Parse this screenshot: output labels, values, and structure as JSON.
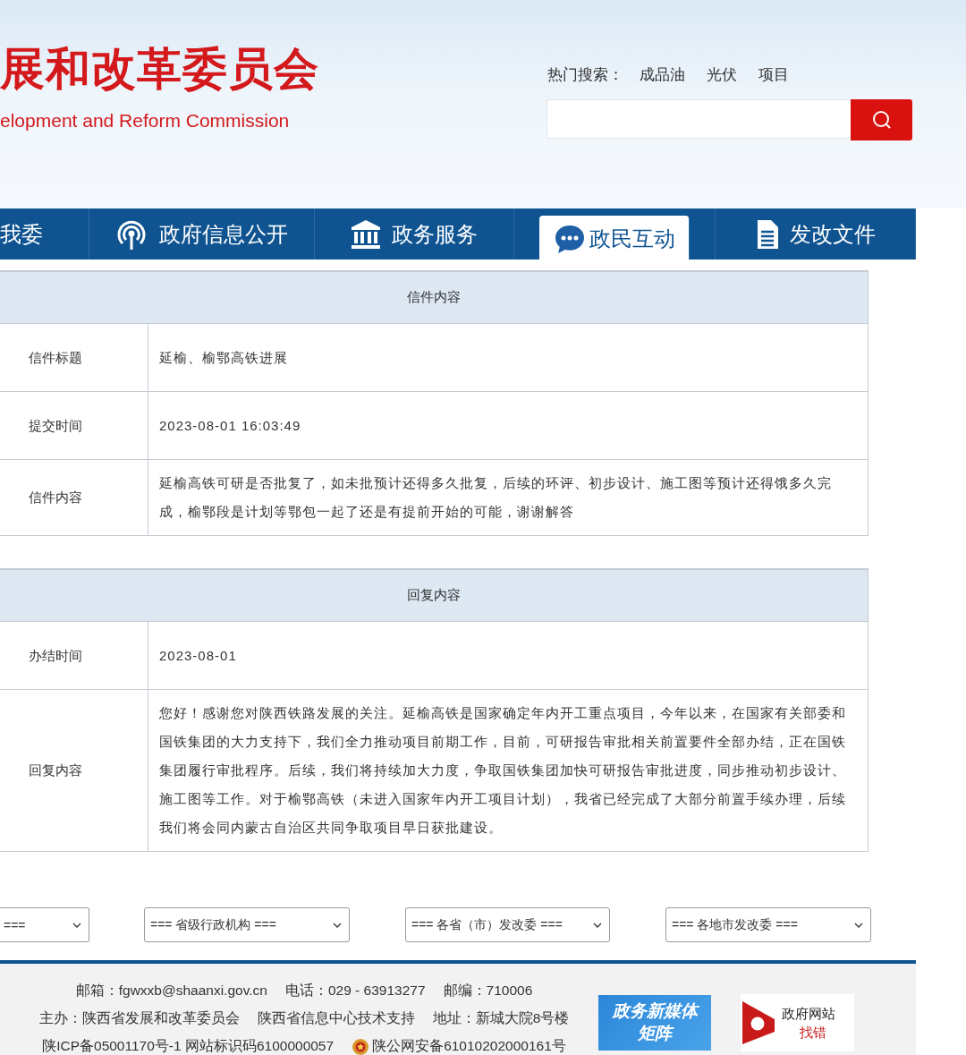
{
  "header": {
    "title": "展和改革委员会",
    "subtitle": "elopment and Reform Commission",
    "hot_search_label": "热门搜索：",
    "hot_searches": [
      "成品油",
      "光伏",
      "项目"
    ]
  },
  "nav": [
    {
      "label": "我委",
      "kind": "plain",
      "selected": false
    },
    {
      "label": "政府信息公开",
      "kind": "antenna",
      "selected": false
    },
    {
      "label": "政务服务",
      "kind": "building",
      "selected": false
    },
    {
      "label": "政民互动",
      "kind": "chat",
      "selected": true
    },
    {
      "label": "发改文件",
      "kind": "document",
      "selected": false
    }
  ],
  "letter": {
    "title": "信件内容",
    "rows": [
      {
        "label": "信件标题",
        "value": "延榆、榆鄂高铁进展"
      },
      {
        "label": "提交时间",
        "value": "2023-08-01 16:03:49"
      },
      {
        "label": "信件内容",
        "value": "延榆高铁可研是否批复了，如未批预计还得多久批复，后续的环评、初步设计、施工图等预计还得饿多久完成，榆鄂段是计划等鄂包一起了还是有提前开始的可能，谢谢解答"
      }
    ]
  },
  "reply": {
    "title": "回复内容",
    "rows": [
      {
        "label": "办结时间",
        "value": "2023-08-01"
      },
      {
        "label": "回复内容",
        "value": "您好！感谢您对陕西铁路发展的关注。延榆高铁是国家确定年内开工重点项目，今年以来，在国家有关部委和国铁集团的大力支持下，我们全力推动项目前期工作，目前，可研报告审批相关前置要件全部办结，正在国铁集团履行审批程序。后续，我们将持续加大力度，争取国铁集团加快可研报告审批进度，同步推动初步设计、施工图等工作。对于榆鄂高铁（未进入国家年内开工项目计划），我省已经完成了大部分前置手续办理，后续我们将会同内蒙古自治区共同争取项目早日获批建设。"
      }
    ]
  },
  "dropdowns": [
    "===",
    "=== 省级行政机构 ===",
    "=== 各省（市）发改委 ===",
    "=== 各地市发改委 ==="
  ],
  "footer": {
    "lines": [
      [
        {
          "kind": "text",
          "text": "邮箱：fgwxxb@shaanxi.gov.cn"
        },
        {
          "kind": "text",
          "text": "电话：029 - 63913277"
        },
        {
          "kind": "text",
          "text": "邮编：710006"
        }
      ],
      [
        {
          "kind": "text",
          "text": "主办：陕西省发展和改革委员会"
        },
        {
          "kind": "text",
          "text": "陕西省信息中心技术支持"
        },
        {
          "kind": "text",
          "text": "地址：新城大院8号楼"
        }
      ],
      [
        {
          "kind": "text",
          "text": "陕ICP备05001170号-1 网站标识码6100000057"
        },
        {
          "kind": "emblem",
          "text": "陕公网安备61010202000161号"
        }
      ]
    ],
    "badges": [
      {
        "kind": "media",
        "lines": [
          "政务新媒体",
          "矩阵"
        ]
      },
      {
        "kind": "error",
        "lines": [
          "政府网站",
          "找错"
        ]
      }
    ]
  }
}
